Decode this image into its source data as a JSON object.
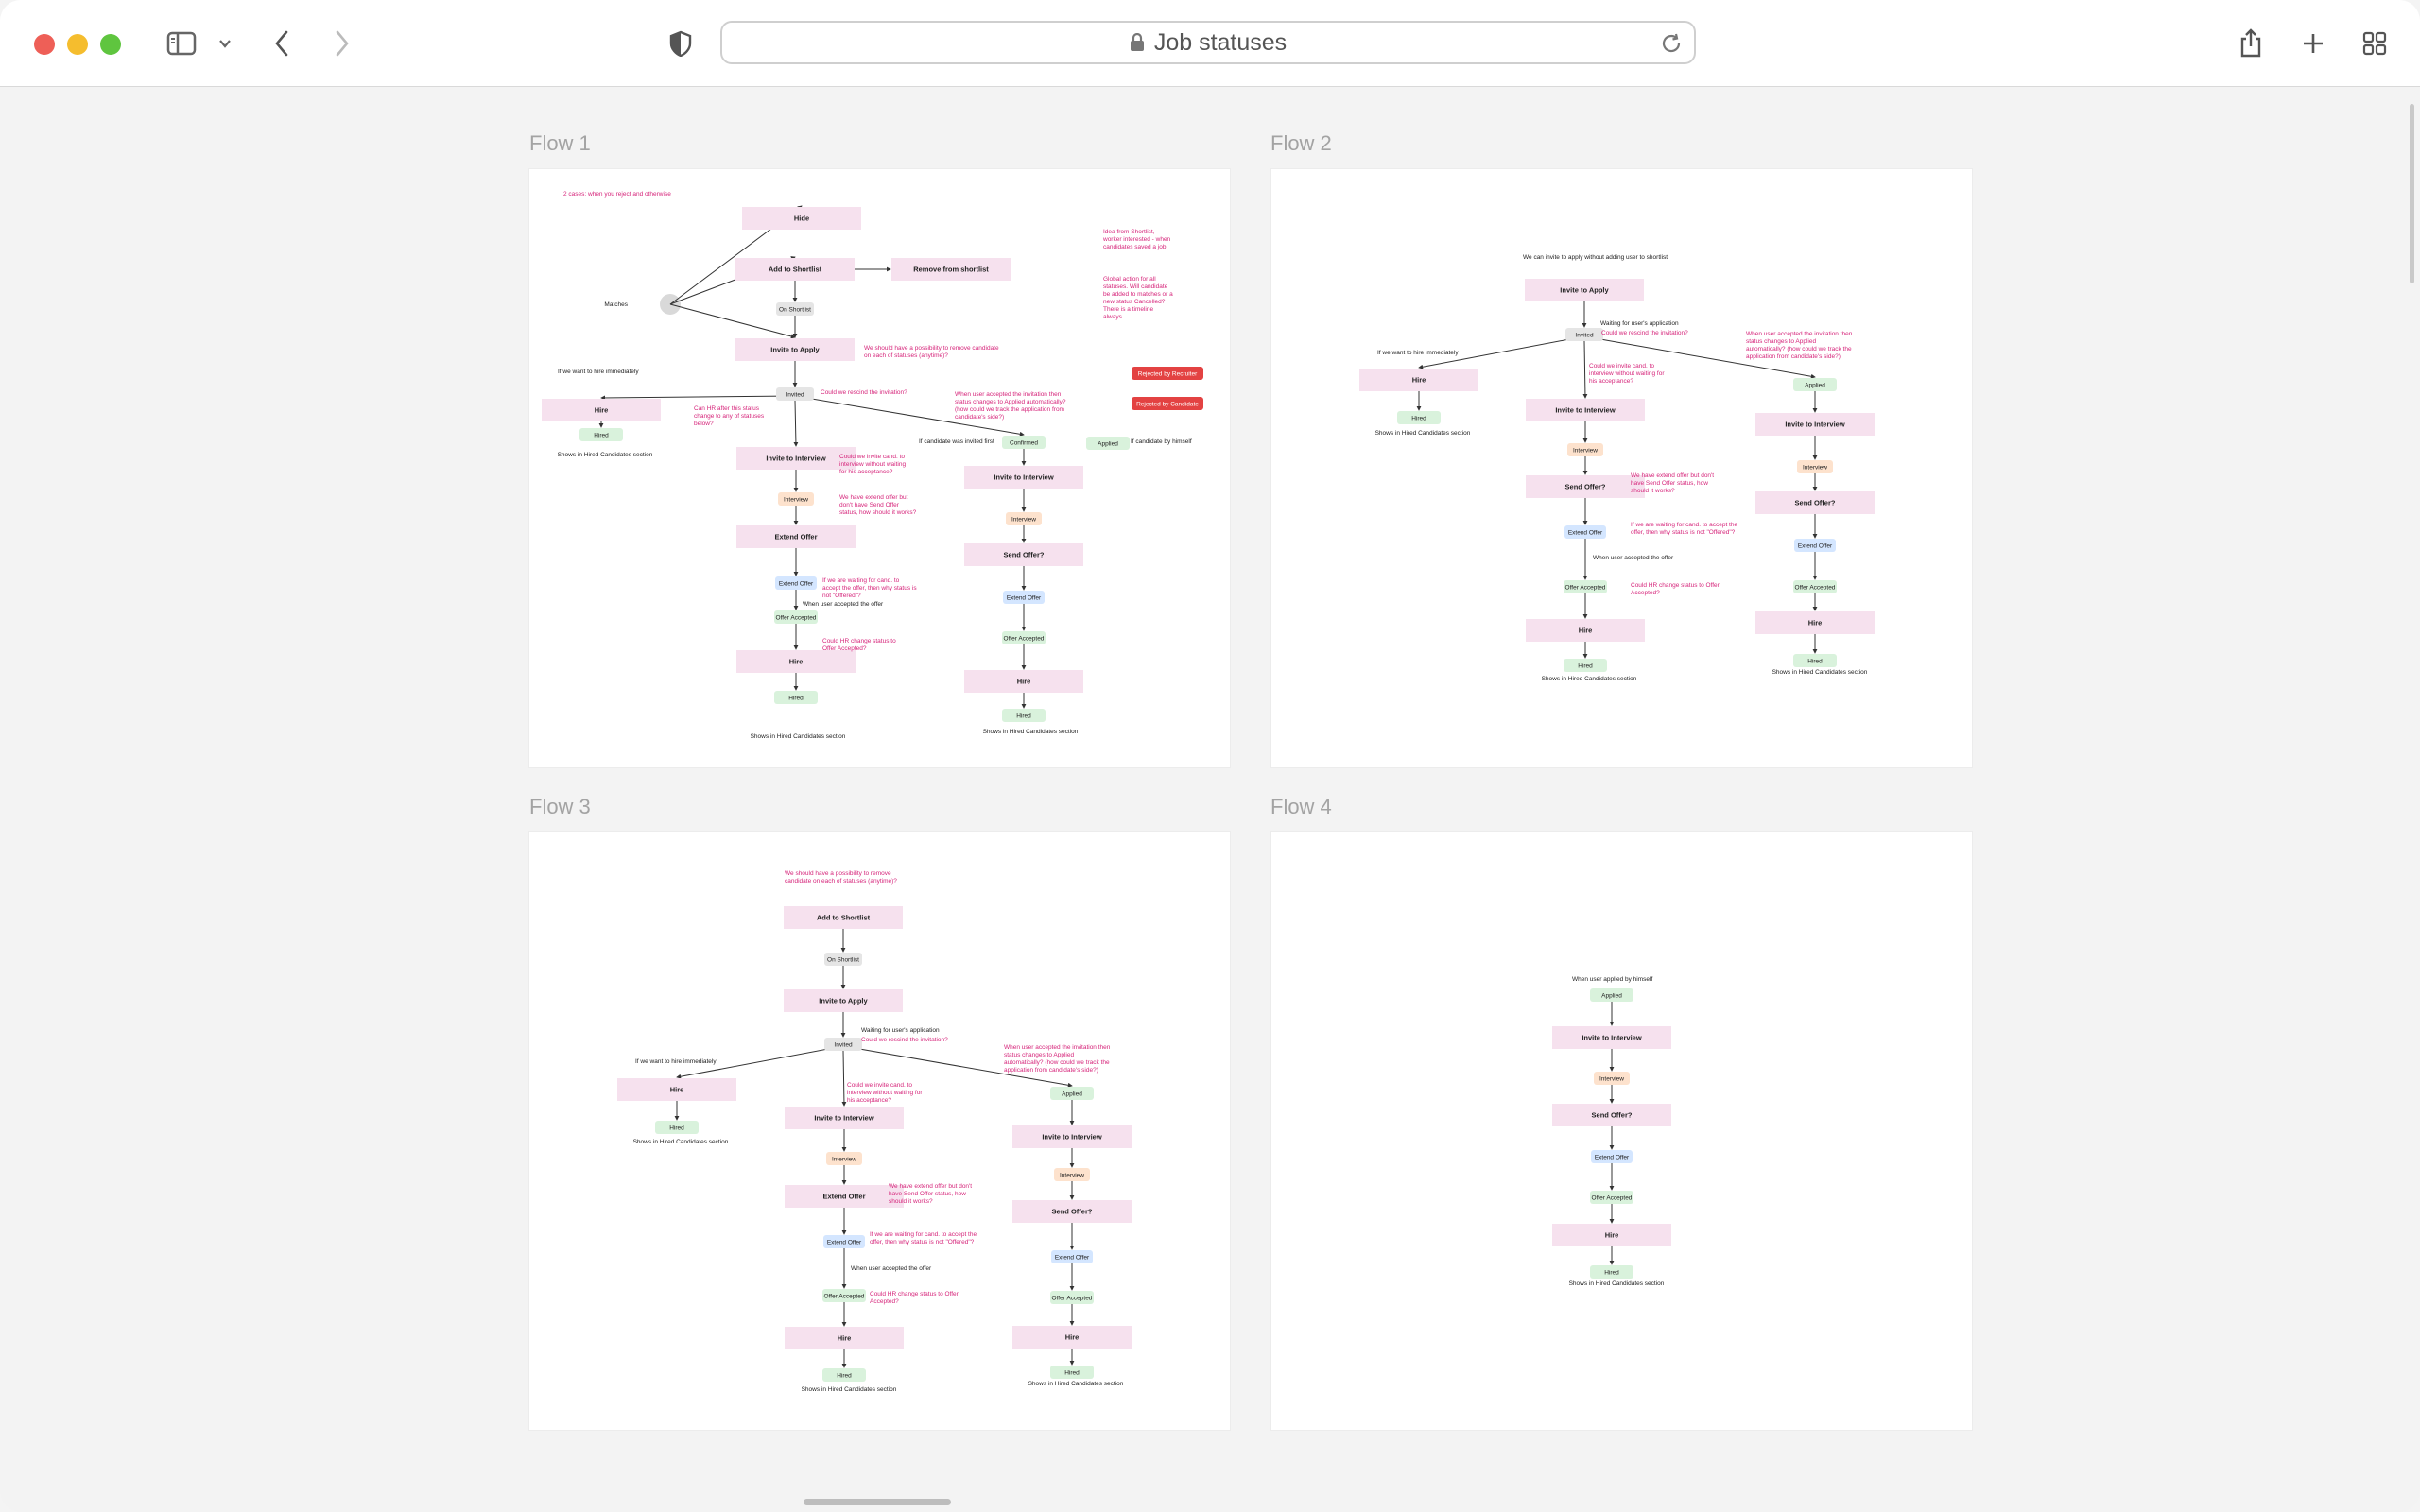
{
  "browser": {
    "address": "Job statuses",
    "icons": [
      "sidebar-icon",
      "chevron-down-icon",
      "back-icon",
      "forward-icon",
      "privacy-shield-icon",
      "lock-icon",
      "reload-icon",
      "share-icon",
      "plus-icon",
      "tab-overview-icon"
    ]
  },
  "colors": {
    "box": "#f6e1ee",
    "note": "#d6247a",
    "green": "#d9f2dc",
    "blue": "#d4e6ff",
    "orange": "#fde2cd",
    "grey": "#e5e5e5",
    "red": "#e34242"
  },
  "flows": [
    {
      "title": "Flow 1",
      "nodes": [
        {
          "t": "Hide",
          "k": "box"
        },
        {
          "t": "Add to Shortlist",
          "k": "box"
        },
        {
          "t": "Remove from shortlist",
          "k": "box"
        },
        {
          "t": "On Shortlist",
          "k": "grey"
        },
        {
          "t": "Invite to Apply",
          "k": "box"
        },
        {
          "t": "Invited",
          "k": "grey"
        },
        {
          "t": "Hire",
          "k": "box"
        },
        {
          "t": "Hired",
          "k": "green"
        },
        {
          "t": "Invite to Interview",
          "k": "box"
        },
        {
          "t": "Interview",
          "k": "orange"
        },
        {
          "t": "Extend Offer",
          "k": "box"
        },
        {
          "t": "Extend Offer",
          "k": "blue"
        },
        {
          "t": "Offer Accepted",
          "k": "green"
        },
        {
          "t": "Hire",
          "k": "box"
        },
        {
          "t": "Hired",
          "k": "green"
        },
        {
          "t": "Confirmed",
          "k": "green"
        },
        {
          "t": "Invite to Interview",
          "k": "box"
        },
        {
          "t": "Interview",
          "k": "orange"
        },
        {
          "t": "Send Offer?",
          "k": "box"
        },
        {
          "t": "Extend Offer",
          "k": "blue"
        },
        {
          "t": "Offer Accepted",
          "k": "green"
        },
        {
          "t": "Hire",
          "k": "box"
        },
        {
          "t": "Hired",
          "k": "green"
        },
        {
          "t": "Applied",
          "k": "green"
        },
        {
          "t": "Rejected by Recruiter",
          "k": "red"
        },
        {
          "t": "Rejected by Candidate",
          "k": "red"
        }
      ],
      "labels": [
        "Matches",
        "If we want to hire immediately",
        "Shows in Hired Candidates section",
        "When user accepted the offer",
        "Shows in Hired Candidates section",
        "Shows in Hired Candidates section",
        "If candidate was invited first",
        "If candidate by himself"
      ],
      "notes": [
        "2 cases: when you reject and otherwise",
        "Idea from Shortlist, worker interested - when candidates saved a job",
        "Global action for all statuses. Will candidate be added to matches or a new status Cancelled? There is a timeline always",
        "We should have a possibility to remove candidate on each of statuses (anytime)?",
        "Could we rescind the invitation?",
        "Can HR after this status change to any of statuses below?",
        "When user accepted the invitation then status changes to Applied automatically? (how could we track the application from candidate's side?)",
        "Could we invite cand. to interview without waiting for his acceptance?",
        "We have extend offer but don't have Send Offer status, how should it works?",
        "If we are waiting for cand. to accept the offer, then why status is not \"Offered\"?",
        "Could HR change status to Offer Accepted?"
      ]
    },
    {
      "title": "Flow 2",
      "nodes": [
        {
          "t": "Invite to Apply",
          "k": "box"
        },
        {
          "t": "Invited",
          "k": "grey"
        },
        {
          "t": "Hire",
          "k": "box"
        },
        {
          "t": "Hired",
          "k": "green"
        },
        {
          "t": "Invite to Interview",
          "k": "box"
        },
        {
          "t": "Interview",
          "k": "orange"
        },
        {
          "t": "Send Offer?",
          "k": "box"
        },
        {
          "t": "Extend Offer",
          "k": "blue"
        },
        {
          "t": "Offer Accepted",
          "k": "green"
        },
        {
          "t": "Hire",
          "k": "box"
        },
        {
          "t": "Hired",
          "k": "green"
        },
        {
          "t": "Applied",
          "k": "green"
        },
        {
          "t": "Invite to Interview",
          "k": "box"
        },
        {
          "t": "Interview",
          "k": "orange"
        },
        {
          "t": "Send Offer?",
          "k": "box"
        },
        {
          "t": "Extend Offer",
          "k": "blue"
        },
        {
          "t": "Offer Accepted",
          "k": "green"
        },
        {
          "t": "Hire",
          "k": "box"
        },
        {
          "t": "Hired",
          "k": "green"
        }
      ],
      "labels": [
        "We can invite to apply without adding user to shortlist",
        "Waiting for user's application",
        "If we want to hire immediately",
        "Shows in Hired Candidates section",
        "When user accepted the offer",
        "Shows in Hired Candidates section",
        "Shows in Hired Candidates section"
      ],
      "notes": [
        "Could we rescind the invitation?",
        "When user accepted the invitation then status changes to Applied automatically? (how could we track the application from candidate's side?)",
        "Could we invite cand. to interview without waiting for his acceptance?",
        "We have extend offer but don't have Send Offer status, how should it works?",
        "If we are waiting for cand. to accept the offer, then why status is not \"Offered\"?",
        "Could HR change status to Offer Accepted?"
      ]
    },
    {
      "title": "Flow 3",
      "nodes": [
        {
          "t": "Add to Shortlist",
          "k": "box"
        },
        {
          "t": "On Shortlist",
          "k": "grey"
        },
        {
          "t": "Invite to Apply",
          "k": "box"
        },
        {
          "t": "Invited",
          "k": "grey"
        },
        {
          "t": "Hire",
          "k": "box"
        },
        {
          "t": "Hired",
          "k": "green"
        },
        {
          "t": "Invite to Interview",
          "k": "box"
        },
        {
          "t": "Interview",
          "k": "orange"
        },
        {
          "t": "Extend Offer",
          "k": "box"
        },
        {
          "t": "Extend Offer",
          "k": "blue"
        },
        {
          "t": "Offer Accepted",
          "k": "green"
        },
        {
          "t": "Hire",
          "k": "box"
        },
        {
          "t": "Hired",
          "k": "green"
        },
        {
          "t": "Applied",
          "k": "green"
        },
        {
          "t": "Invite to Interview",
          "k": "box"
        },
        {
          "t": "Interview",
          "k": "orange"
        },
        {
          "t": "Send Offer?",
          "k": "box"
        },
        {
          "t": "Extend Offer",
          "k": "blue"
        },
        {
          "t": "Offer Accepted",
          "k": "green"
        },
        {
          "t": "Hire",
          "k": "box"
        },
        {
          "t": "Hired",
          "k": "green"
        }
      ],
      "labels": [
        "Waiting for user's application",
        "If we want to hire immediately",
        "Shows in Hired Candidates section",
        "When user accepted the offer",
        "Shows in Hired Candidates section",
        "Shows in Hired Candidates section"
      ],
      "notes": [
        "We should have a possibility to remove candidate on each of statuses (anytime)?",
        "Could we rescind the invitation?",
        "When user accepted the invitation then status changes to Applied automatically? (how could we track the application from candidate's side?)",
        "Could we invite cand. to interview without waiting for his acceptance?",
        "We have extend offer but don't have Send Offer status, how should it works?",
        "If we are waiting for cand. to accept the offer, then why status is not \"Offered\"?",
        "Could HR change status to Offer Accepted?"
      ]
    },
    {
      "title": "Flow 4",
      "nodes": [
        {
          "t": "Applied",
          "k": "green"
        },
        {
          "t": "Invite to Interview",
          "k": "box"
        },
        {
          "t": "Interview",
          "k": "orange"
        },
        {
          "t": "Send Offer?",
          "k": "box"
        },
        {
          "t": "Extend Offer",
          "k": "blue"
        },
        {
          "t": "Offer Accepted",
          "k": "green"
        },
        {
          "t": "Hire",
          "k": "box"
        },
        {
          "t": "Hired",
          "k": "green"
        }
      ],
      "labels": [
        "When user applied by himself",
        "Shows in Hired Candidates section"
      ],
      "notes": []
    }
  ]
}
